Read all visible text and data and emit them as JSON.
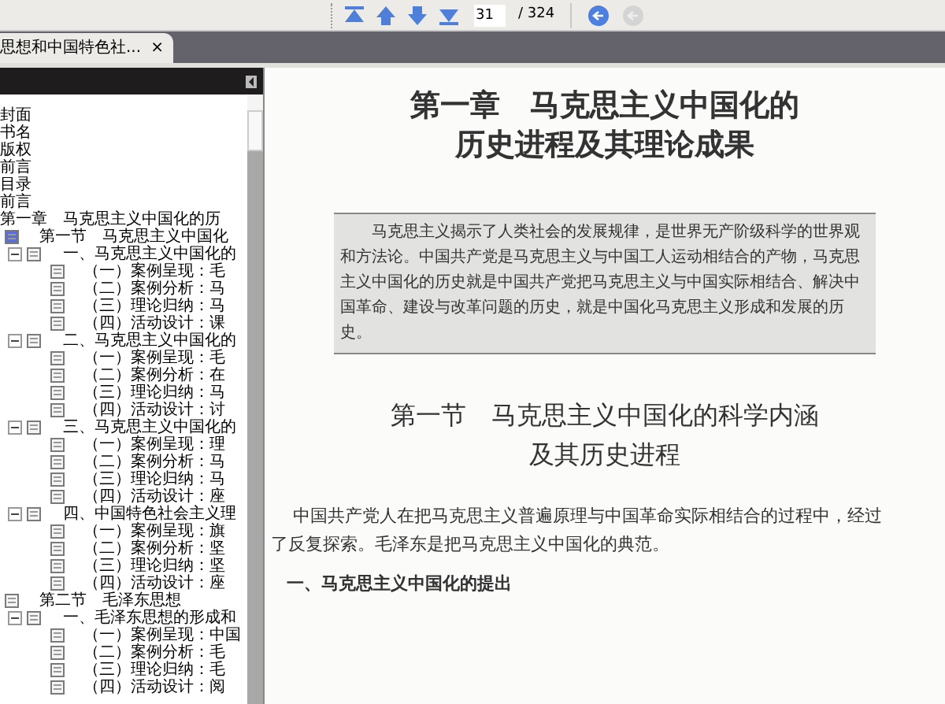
{
  "toolbar": {
    "page_input": "31",
    "page_total": "/ 324",
    "go_disabled": false,
    "back_disabled": true
  },
  "tabs": [
    {
      "label": "思想和中国特色社...",
      "close": "×",
      "selected": true
    }
  ],
  "outline": [
    {
      "label": "封面"
    },
    {
      "label": "书名"
    },
    {
      "label": "版权"
    },
    {
      "label": "前言"
    },
    {
      "label": "目录"
    },
    {
      "label": "前言"
    },
    {
      "label": "第一章　马克思主义中国化的历",
      "children": [
        {
          "label": "第一节　马克思主义中国化",
          "children": [
            {
              "label": "一、马克思主义中国化的",
              "expanded": true,
              "children": [
                {
                  "label": "（一）案例呈现：毛"
                },
                {
                  "label": "（二）案例分析：马"
                },
                {
                  "label": "（三）理论归纳：马"
                },
                {
                  "label": "（四）活动设计：课"
                }
              ]
            },
            {
              "label": "二、马克思主义中国化的",
              "expanded": true,
              "children": [
                {
                  "label": "（一）案例呈现：毛"
                },
                {
                  "label": "（二）案例分析：在"
                },
                {
                  "label": "（三）理论归纳：马"
                },
                {
                  "label": "（四）活动设计：讨"
                }
              ]
            },
            {
              "label": "三、马克思主义中国化的",
              "expanded": true,
              "children": [
                {
                  "label": "（一）案例呈现：理"
                },
                {
                  "label": "（二）案例分析：马"
                },
                {
                  "label": "（三）理论归纳：马"
                },
                {
                  "label": "（四）活动设计：座"
                }
              ]
            },
            {
              "label": "四、中国特色社会主义理",
              "expanded": true,
              "children": [
                {
                  "label": "（一）案例呈现：旗"
                },
                {
                  "label": "（二）案例分析：坚"
                },
                {
                  "label": "（三）理论归纳：坚"
                },
                {
                  "label": "（四）活动设计：座"
                }
              ]
            }
          ]
        },
        {
          "label": "第二节　毛泽东思想",
          "children": [
            {
              "label": "一、毛泽东思想的形成和",
              "expanded": true,
              "children": [
                {
                  "label": "（一）案例呈现：中国"
                },
                {
                  "label": "（二）案例分析：毛"
                },
                {
                  "label": "（三）理论归纳：毛"
                },
                {
                  "label": "（四）活动设计：阅"
                }
              ]
            }
          ]
        }
      ]
    }
  ],
  "document": {
    "chapter_title": [
      "第一章　马克思主义中国化的",
      "历史进程及其理论成果"
    ],
    "summary": "马克思主义揭示了人类社会的发展规律，是世界无产阶级科学的世界观和方法论。中国共产党是马克思主义与中国工人运动相结合的产物，马克思主义中国化的历史就是中国共产党把马克思主义与中国实际相结合、解决中国革命、建设与改革问题的历史，就是中国化马克思主义形成和发展的历史。",
    "section_title": [
      "第一节　马克思主义中国化的科学内涵",
      "及其历史进程"
    ],
    "paragraph_lines": [
      "中国共产党人在把马克思主义普遍原理与中国革命实际相结合的过程中，经过",
      "了反复探索。毛泽东是把马克思主义中国化的典范。"
    ],
    "subheading": "一、马克思主义中国化的提出"
  }
}
